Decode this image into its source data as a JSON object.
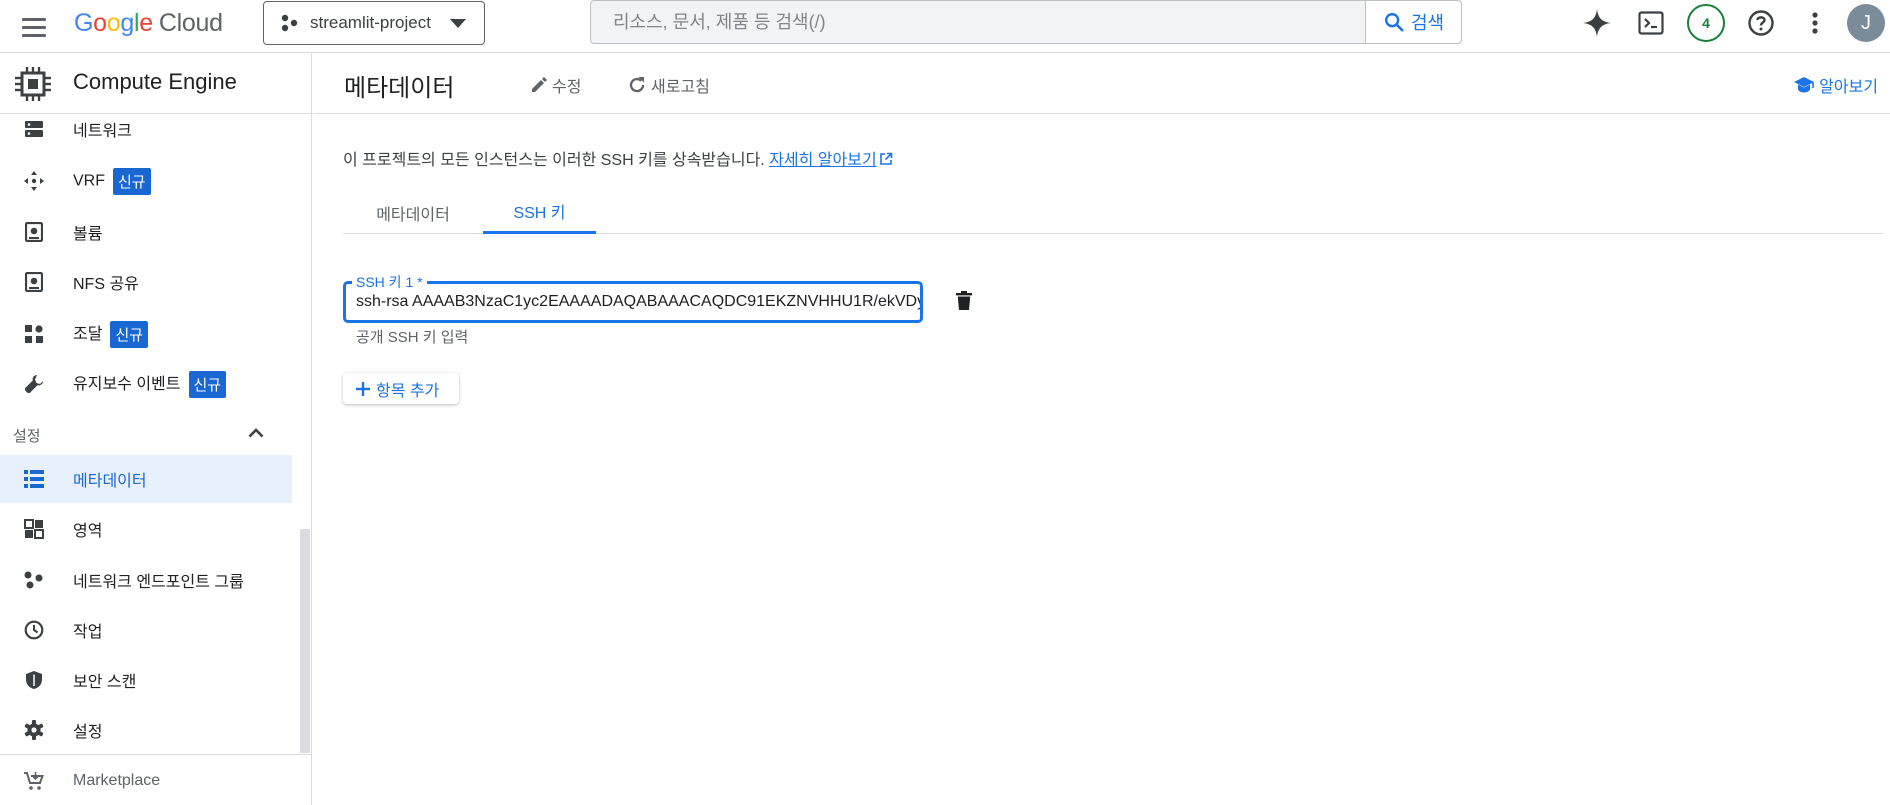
{
  "topbar": {
    "logo_google": [
      "G",
      "o",
      "o",
      "g",
      "l",
      "e"
    ],
    "logo_cloud": "Cloud",
    "project_name": "streamlit-project",
    "search_placeholder": "리소스, 문서, 제품 등 검색(/)",
    "search_button_label": "검색",
    "notification_count": "4",
    "avatar_initial": "J"
  },
  "sidebar": {
    "product_title": "Compute Engine",
    "items_top": [
      {
        "label": "네트워크",
        "icon": "network-storage-icon",
        "badge": ""
      },
      {
        "label": "VRF",
        "icon": "vrf-icon",
        "badge": "신규"
      },
      {
        "label": "볼륨",
        "icon": "volume-icon",
        "badge": ""
      },
      {
        "label": "NFS 공유",
        "icon": "nfs-share-icon",
        "badge": ""
      },
      {
        "label": "조달",
        "icon": "procurement-icon",
        "badge": "신규"
      },
      {
        "label": "유지보수 이벤트",
        "icon": "wrench-icon",
        "badge": "신규"
      }
    ],
    "section_label": "설정",
    "items_settings": [
      {
        "label": "메타데이터",
        "icon": "metadata-list-icon",
        "active": true
      },
      {
        "label": "영역",
        "icon": "zones-icon"
      },
      {
        "label": "네트워크 엔드포인트 그룹",
        "icon": "endpoint-group-icon"
      },
      {
        "label": "작업",
        "icon": "clock-icon"
      },
      {
        "label": "보안 스캔",
        "icon": "shield-icon"
      },
      {
        "label": "설정",
        "icon": "gear-icon"
      }
    ],
    "marketplace_label": "Marketplace"
  },
  "main": {
    "page_title": "메타데이터",
    "edit_label": "수정",
    "refresh_label": "새로고침",
    "learn_label": "알아보기",
    "description": "이 프로젝트의 모든 인스턴스는 이러한 SSH 키를 상속받습니다.",
    "learn_more_link": "자세히 알아보기",
    "tabs": [
      {
        "label": "메타데이터",
        "active": false
      },
      {
        "label": "SSH 키",
        "active": true
      }
    ],
    "ssh_field_label": "SSH 키 1 *",
    "ssh_field_value": "ssh-rsa AAAAB3NzaC1yc2EAAAADAQABAAACAQDC91EKZNVHHU1R/ekVDy",
    "ssh_field_hint": "공개 SSH 키 입력",
    "add_item_label": "항목 추가"
  },
  "colors": {
    "accent": "#1a73e8",
    "active_nav_bg": "#e8f0fe",
    "badge_bg": "#1967d2",
    "notif_green": "#188038"
  }
}
